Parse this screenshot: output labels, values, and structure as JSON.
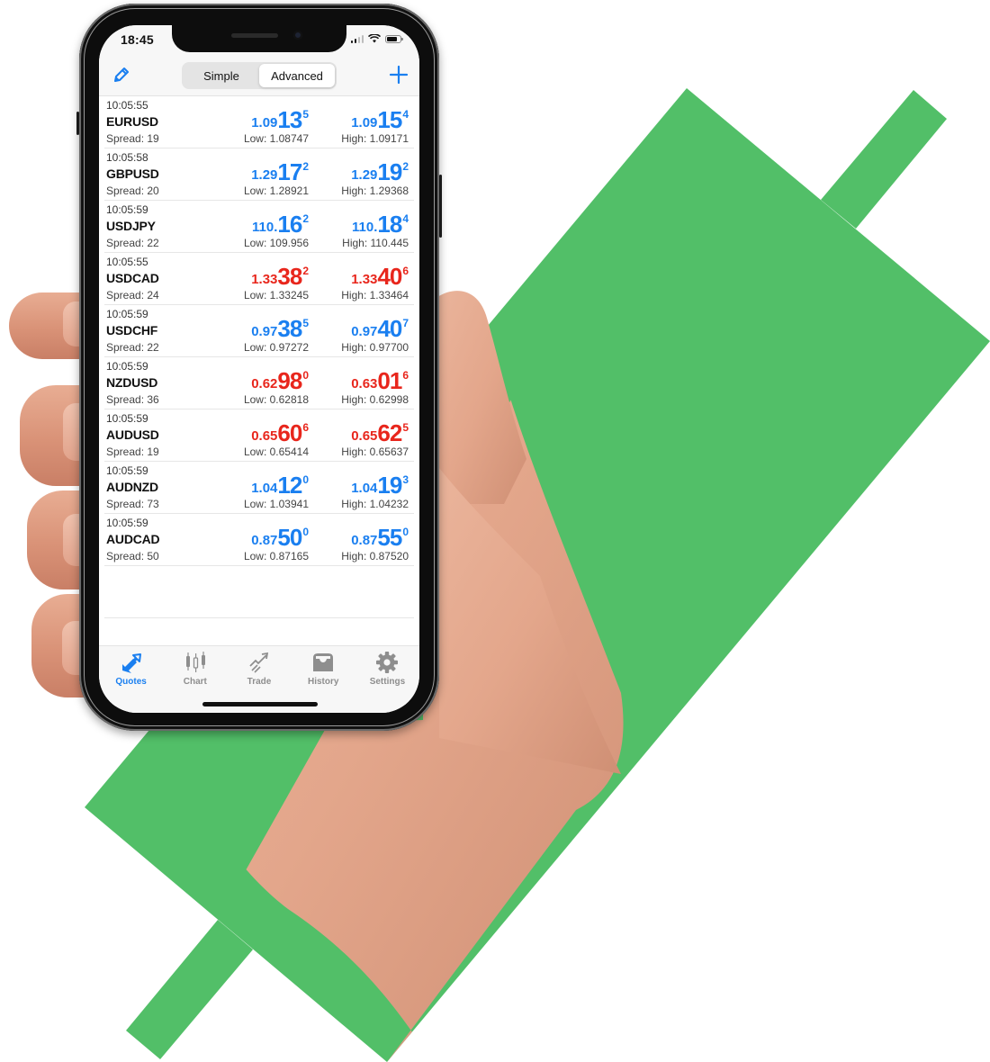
{
  "theme": {
    "green": "#52bf68",
    "blue": "#1a7ff0",
    "red": "#e8261c",
    "tab_inactive": "#8e8e8e"
  },
  "status_bar": {
    "time": "18:45",
    "icons": [
      "cellular-signal-icon",
      "wifi-icon",
      "battery-icon"
    ]
  },
  "nav": {
    "left_icon": "pencil-edit-icon",
    "right_icon": "plus-icon",
    "segments": [
      {
        "label": "Simple",
        "active": false
      },
      {
        "label": "Advanced",
        "active": true
      }
    ]
  },
  "quotes": [
    {
      "time": "10:05:55",
      "symbol": "EURUSD",
      "spread": "Spread: 19",
      "direction": "up",
      "bid": {
        "small": "1.09",
        "big": "13",
        "sup": "5"
      },
      "ask": {
        "small": "1.09",
        "big": "15",
        "sup": "4"
      },
      "low": "Low: 1.08747",
      "high": "High: 1.09171"
    },
    {
      "time": "10:05:58",
      "symbol": "GBPUSD",
      "spread": "Spread: 20",
      "direction": "up",
      "bid": {
        "small": "1.29",
        "big": "17",
        "sup": "2"
      },
      "ask": {
        "small": "1.29",
        "big": "19",
        "sup": "2"
      },
      "low": "Low: 1.28921",
      "high": "High: 1.29368"
    },
    {
      "time": "10:05:59",
      "symbol": "USDJPY",
      "spread": "Spread: 22",
      "direction": "up",
      "bid": {
        "small": "110.",
        "big": "16",
        "sup": "2"
      },
      "ask": {
        "small": "110.",
        "big": "18",
        "sup": "4"
      },
      "low": "Low: 109.956",
      "high": "High: 110.445"
    },
    {
      "time": "10:05:55",
      "symbol": "USDCAD",
      "spread": "Spread: 24",
      "direction": "down",
      "bid": {
        "small": "1.33",
        "big": "38",
        "sup": "2"
      },
      "ask": {
        "small": "1.33",
        "big": "40",
        "sup": "6"
      },
      "low": "Low: 1.33245",
      "high": "High: 1.33464"
    },
    {
      "time": "10:05:59",
      "symbol": "USDCHF",
      "spread": "Spread: 22",
      "direction": "up",
      "bid": {
        "small": "0.97",
        "big": "38",
        "sup": "5"
      },
      "ask": {
        "small": "0.97",
        "big": "40",
        "sup": "7"
      },
      "low": "Low: 0.97272",
      "high": "High: 0.97700"
    },
    {
      "time": "10:05:59",
      "symbol": "NZDUSD",
      "spread": "Spread: 36",
      "direction": "down",
      "bid": {
        "small": "0.62",
        "big": "98",
        "sup": "0"
      },
      "ask": {
        "small": "0.63",
        "big": "01",
        "sup": "6"
      },
      "low": "Low: 0.62818",
      "high": "High: 0.62998"
    },
    {
      "time": "10:05:59",
      "symbol": "AUDUSD",
      "spread": "Spread: 19",
      "direction": "down",
      "bid": {
        "small": "0.65",
        "big": "60",
        "sup": "6"
      },
      "ask": {
        "small": "0.65",
        "big": "62",
        "sup": "5"
      },
      "low": "Low: 0.65414",
      "high": "High: 0.65637"
    },
    {
      "time": "10:05:59",
      "symbol": "AUDNZD",
      "spread": "Spread: 73",
      "direction": "up",
      "bid": {
        "small": "1.04",
        "big": "12",
        "sup": "0"
      },
      "ask": {
        "small": "1.04",
        "big": "19",
        "sup": "3"
      },
      "low": "Low: 1.03941",
      "high": "High: 1.04232"
    },
    {
      "time": "10:05:59",
      "symbol": "AUDCAD",
      "spread": "Spread: 50",
      "direction": "up",
      "bid": {
        "small": "0.87",
        "big": "50",
        "sup": "0"
      },
      "ask": {
        "small": "0.87",
        "big": "55",
        "sup": "0"
      },
      "low": "Low: 0.87165",
      "high": "High: 0.87520"
    }
  ],
  "tabs": [
    {
      "label": "Quotes",
      "icon": "quotes-arrows-icon",
      "active": true
    },
    {
      "label": "Chart",
      "icon": "candlestick-chart-icon",
      "active": false
    },
    {
      "label": "Trade",
      "icon": "trade-trend-icon",
      "active": false
    },
    {
      "label": "History",
      "icon": "inbox-tray-icon",
      "active": false
    },
    {
      "label": "Settings",
      "icon": "gear-icon",
      "active": false
    }
  ]
}
